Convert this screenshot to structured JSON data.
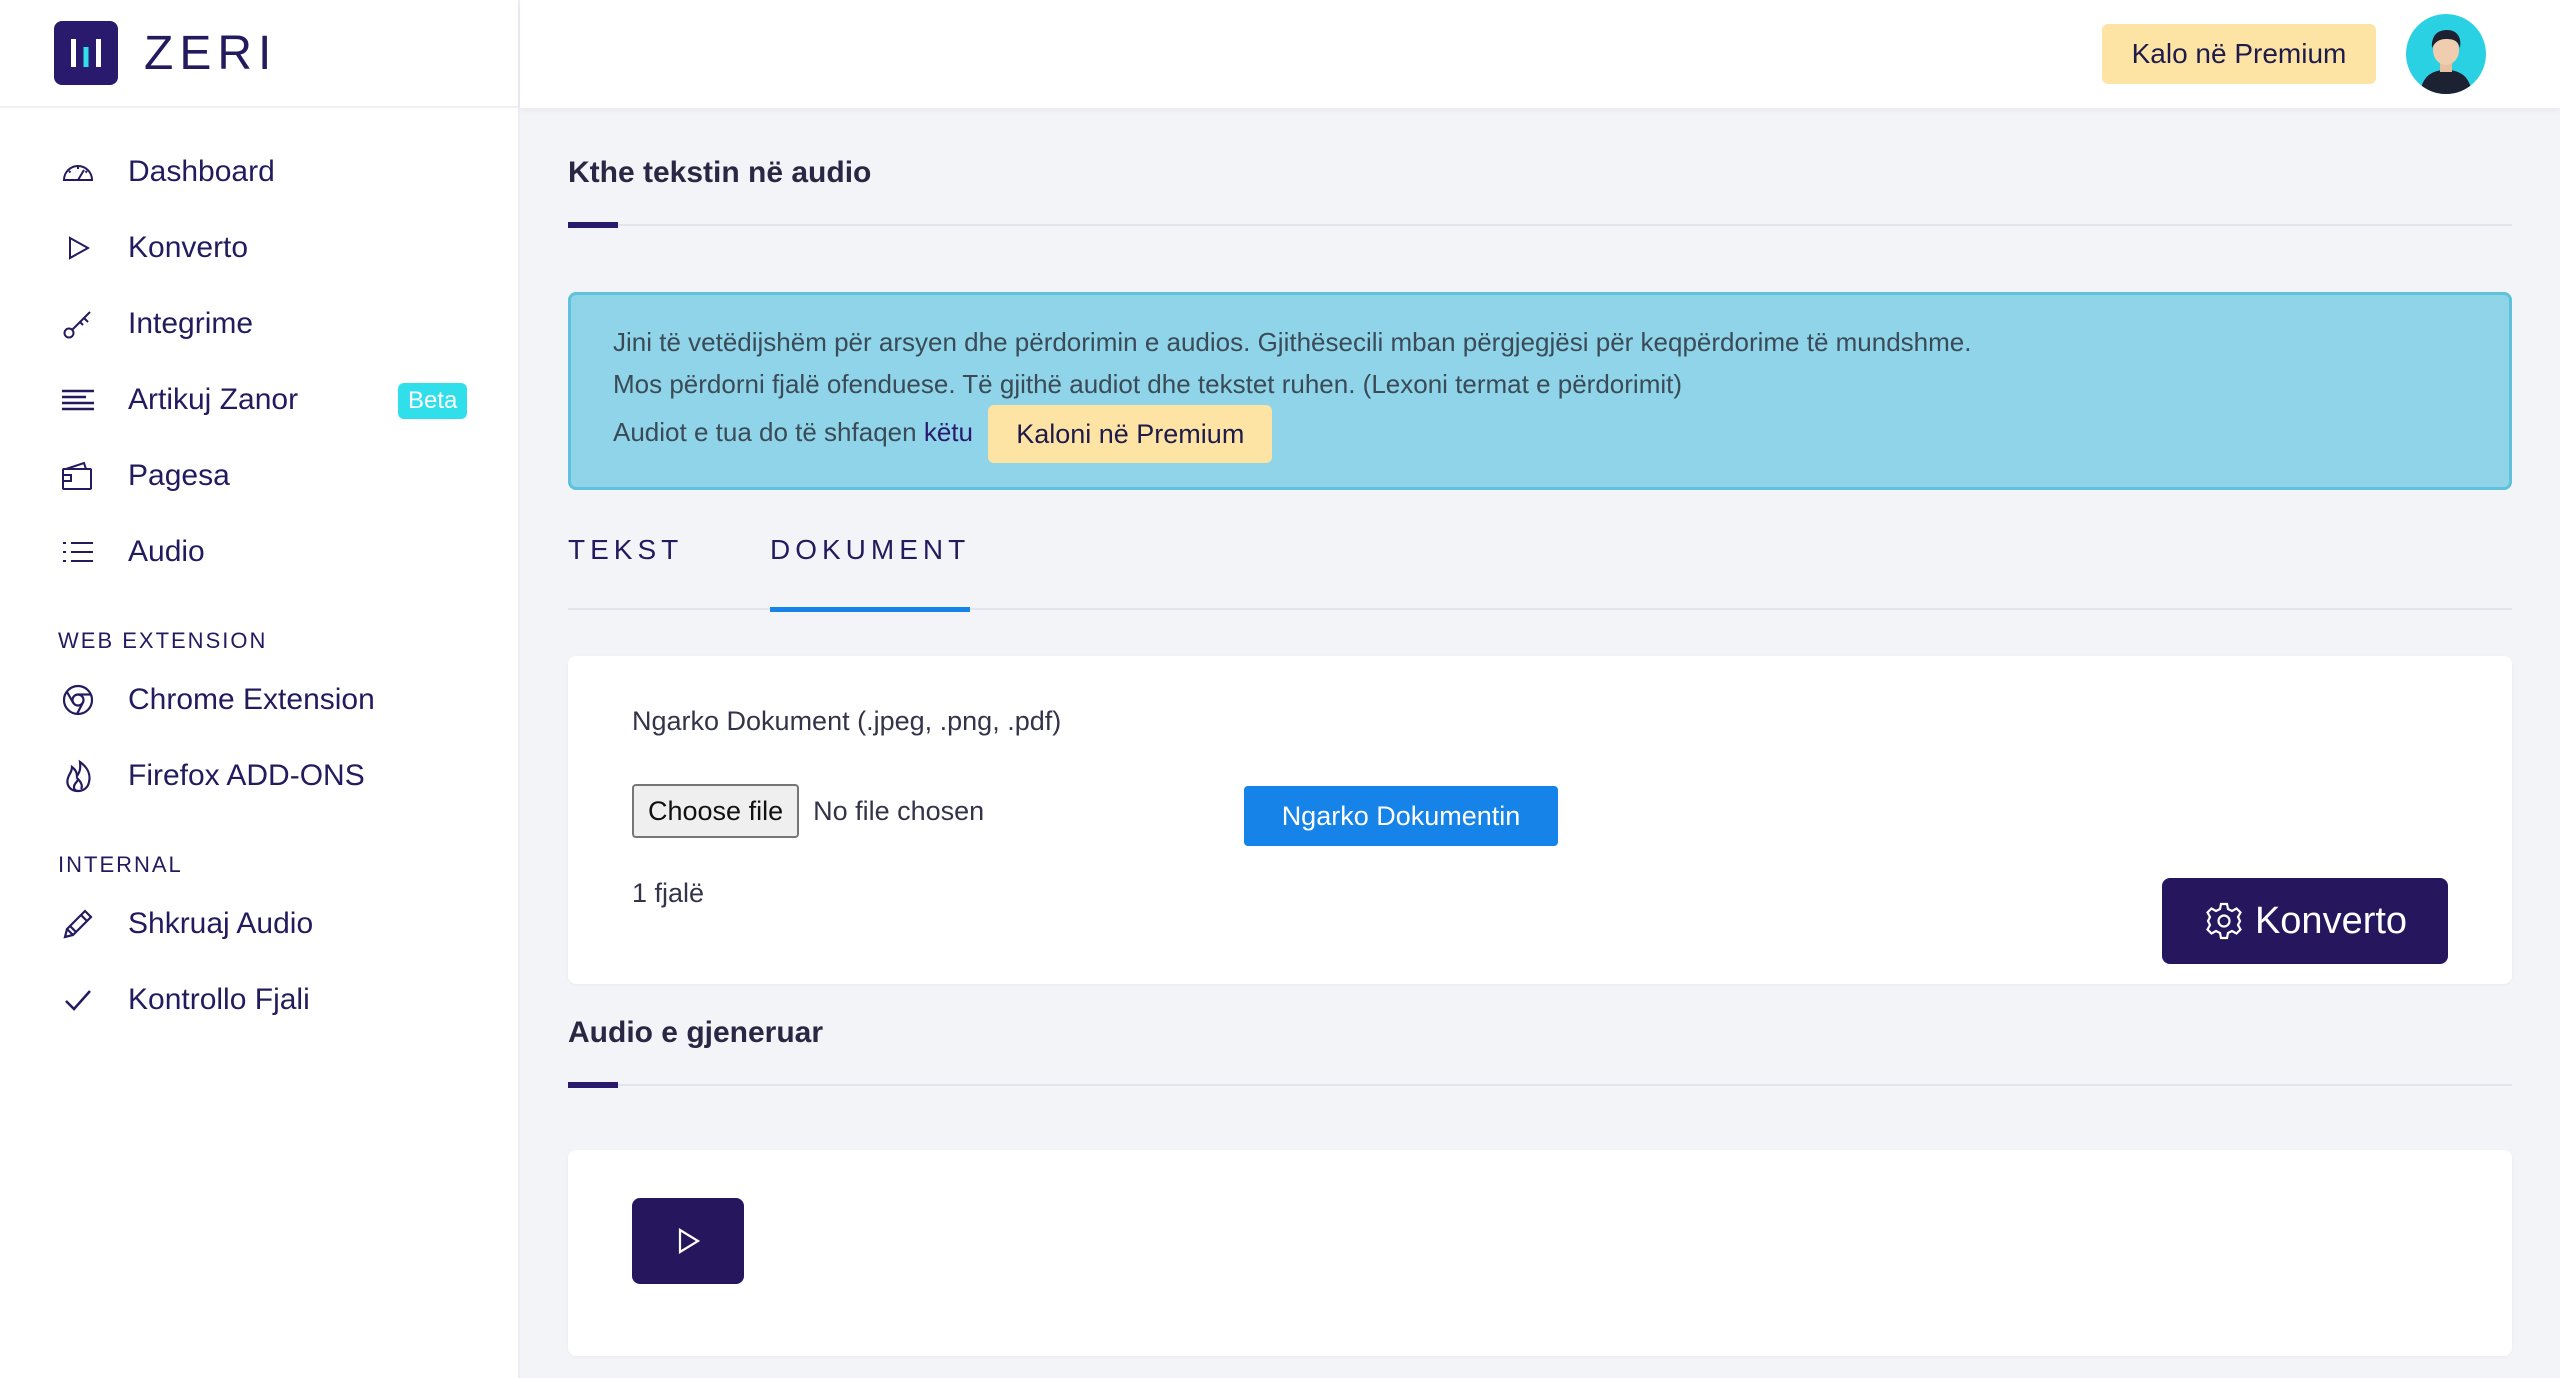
{
  "brand": {
    "name": "ZERI"
  },
  "header": {
    "premium_button": "Kalo në Premium"
  },
  "sidebar": {
    "items": [
      {
        "label": "Dashboard",
        "icon": "speedometer-icon"
      },
      {
        "label": "Konverto",
        "icon": "play-icon"
      },
      {
        "label": "Integrime",
        "icon": "key-icon"
      },
      {
        "label": "Artikuj Zanor",
        "icon": "text-lines-icon",
        "badge": "Beta"
      },
      {
        "label": "Pagesa",
        "icon": "wallet-icon"
      },
      {
        "label": "Audio",
        "icon": "list-icon"
      }
    ],
    "section_web_extension": "WEB EXTENSION",
    "web_items": [
      {
        "label": "Chrome Extension",
        "icon": "chrome-icon"
      },
      {
        "label": "Firefox ADD-ONS",
        "icon": "flame-icon"
      }
    ],
    "section_internal": "INTERNAL",
    "internal_items": [
      {
        "label": "Shkruaj Audio",
        "icon": "pencil-icon"
      },
      {
        "label": "Kontrollo Fjali",
        "icon": "check-icon"
      }
    ]
  },
  "main": {
    "title": "Kthe tekstin në audio",
    "alert": {
      "line1": "Jini të vetëdijshëm për arsyen dhe përdorimin e audios. Gjithësecili mban përgjegjësi për keqpërdorime të mundshme.",
      "line2": "Mos përdorni fjalë ofenduese. Të gjithë audiot dhe tekstet ruhen. (Lexoni termat e përdorimit)",
      "line3_prefix": "Audiot e tua do të shfaqen",
      "line3_link": "këtu",
      "premium_button": "Kaloni në Premium"
    },
    "tabs": [
      {
        "label": "TEKST",
        "active": false
      },
      {
        "label": "DOKUMENT",
        "active": true
      }
    ],
    "upload": {
      "label": "Ngarko Dokument (.jpeg, .png, .pdf)",
      "choose_button": "Choose file",
      "file_status": "No file chosen",
      "upload_button": "Ngarko Dokumentin",
      "word_count": "1 fjalë",
      "convert_button": "Konverto"
    },
    "audio_title": "Audio e gjeneruar"
  },
  "colors": {
    "primary": "#25165e",
    "accent_blue": "#1583e8",
    "premium": "#fde4a4",
    "alert_bg": "#8fd4e8",
    "beta_badge": "#30dfe9"
  }
}
